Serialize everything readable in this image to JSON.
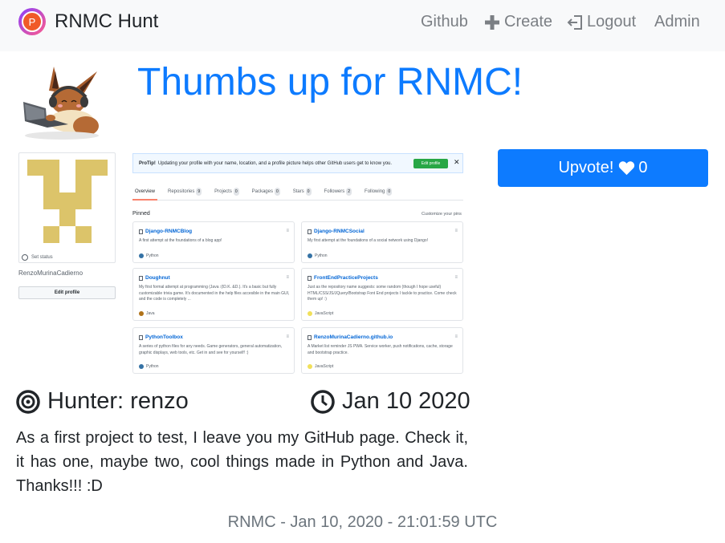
{
  "navbar": {
    "brand_letter": "P",
    "brand_name": "RNMC Hunt",
    "links": {
      "github": "Github",
      "create": "Create",
      "logout": "Logout",
      "admin": "Admin"
    },
    "icons": {
      "create": "plus-icon",
      "logout": "logout-icon"
    }
  },
  "product": {
    "title": "Thumbs up for RNMC!",
    "hunter_label": "Hunter: renzo",
    "date_label": "Jan 10 2020",
    "description": "As a first project to test, I leave you my GitHub page. Check it, it has one, maybe two, cool things made in Python and Java. Thanks!!! :D",
    "upvote_label": "Upvote!",
    "upvote_count": "0"
  },
  "screenshot": {
    "set_status": "Set status",
    "username": "RenzoMurinaCadierno",
    "edit_profile": "Edit profile",
    "protip_bold": "ProTip!",
    "protip_text": "Updating your profile with your name, location, and a profile picture helps other GitHub users get to know you.",
    "protip_button": "Edit profile",
    "protip_close": "✕",
    "tabs": [
      {
        "label": "Overview",
        "count": ""
      },
      {
        "label": "Repositories",
        "count": "9"
      },
      {
        "label": "Projects",
        "count": "0"
      },
      {
        "label": "Packages",
        "count": "0"
      },
      {
        "label": "Stars",
        "count": "0"
      },
      {
        "label": "Followers",
        "count": "2"
      },
      {
        "label": "Following",
        "count": "0"
      }
    ],
    "pinned_label": "Pinned",
    "customize_label": "Customize your pins",
    "cards": [
      {
        "title": "Django-RNMCBlog",
        "desc": "A first attempt at the foundations of a blog app!",
        "lang": "Python",
        "color": "#3572A5"
      },
      {
        "title": "Django-RNMCSocial",
        "desc": "My first attempt at the foundations of a social network using Django!",
        "lang": "Python",
        "color": "#3572A5"
      },
      {
        "title": "Doughnut",
        "desc": "My first formal attempt at programming (Java :(ID.K. &D.). It's a basic but fully customizable trivia game. It's documented in the help files accesible in the main GUI, and the code is completely ...",
        "lang": "Java",
        "color": "#b07219"
      },
      {
        "title": "FrontEndPracticeProjects",
        "desc": "Just as the repository name suggests: some random (though I hope useful) HTML/CSS/JS/JQuery/Bootstrap Font End projects I tackle to practice. Come check them up! :)",
        "lang": "JavaScript",
        "color": "#f1e05a"
      },
      {
        "title": "PythonToolbox",
        "desc": "A series of python files for any needs. Game generators, general automatization, graphic displays, web tools, etc. Get in and see for yourself! :)",
        "lang": "Python",
        "color": "#3572A5"
      },
      {
        "title": "RenzoMurinaCadierno.github.io",
        "desc": "A Market list reminder JS PWA. Service worker, push notifications, cache, storage and bootstrap practice.",
        "lang": "JavaScript",
        "color": "#f1e05a"
      }
    ]
  },
  "footer": {
    "text": "RNMC - Jan 10, 2020 - 21:01:59 UTC"
  },
  "colors": {
    "primary": "#0d7bff",
    "navbar_bg": "#f8f9fa",
    "nav_text": "#7b7f84",
    "identicon": "#dcc46a"
  }
}
